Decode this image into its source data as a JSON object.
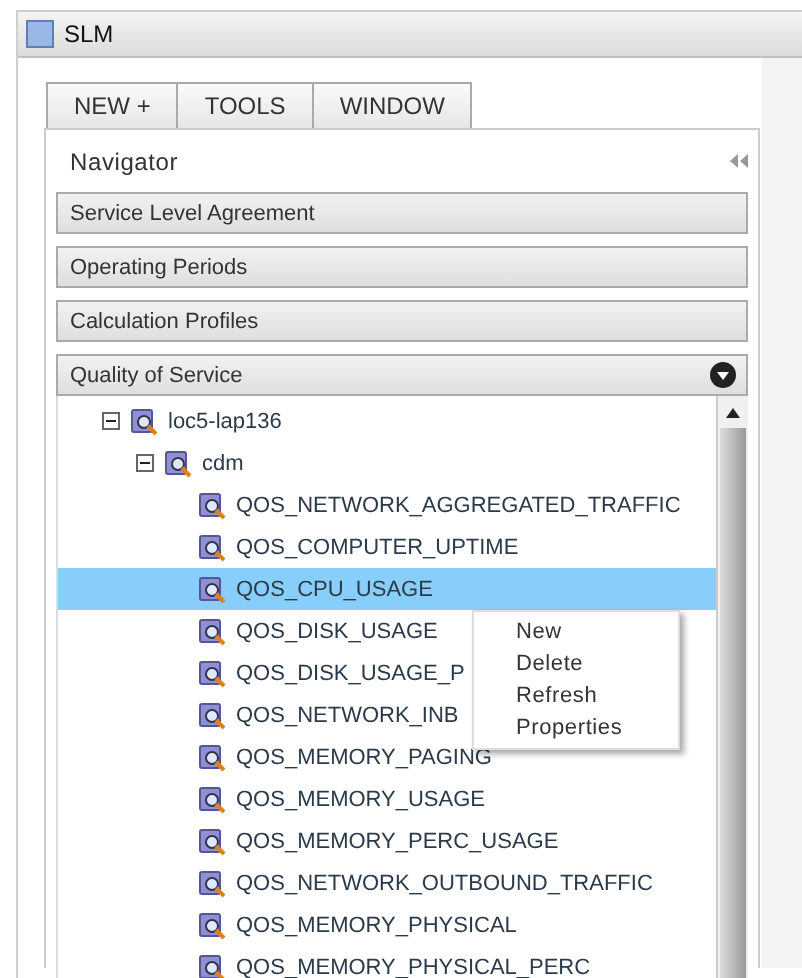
{
  "window": {
    "title": "SLM"
  },
  "menu_tabs": [
    {
      "label": "NEW +"
    },
    {
      "label": "TOOLS"
    },
    {
      "label": "WINDOW"
    }
  ],
  "navigator": {
    "title": "Navigator",
    "sections": [
      {
        "label": "Service Level Agreement",
        "expanded": false
      },
      {
        "label": "Operating Periods",
        "expanded": false
      },
      {
        "label": "Calculation Profiles",
        "expanded": false
      },
      {
        "label": "Quality of Service",
        "expanded": true
      }
    ]
  },
  "tree": [
    {
      "label": "loc5-lap136",
      "expanded": true,
      "selected": false,
      "children": [
        {
          "label": "cdm",
          "expanded": true,
          "selected": false,
          "children": [
            {
              "label": "QOS_NETWORK_AGGREGATED_TRAFFIC",
              "selected": false
            },
            {
              "label": "QOS_COMPUTER_UPTIME",
              "selected": false
            },
            {
              "label": "QOS_CPU_USAGE",
              "selected": true
            },
            {
              "label": "QOS_DISK_USAGE",
              "selected": false
            },
            {
              "label": "QOS_DISK_USAGE_P",
              "selected": false
            },
            {
              "label": "QOS_NETWORK_INB",
              "selected": false
            },
            {
              "label": "QOS_MEMORY_PAGING",
              "selected": false
            },
            {
              "label": "QOS_MEMORY_USAGE",
              "selected": false
            },
            {
              "label": "QOS_MEMORY_PERC_USAGE",
              "selected": false
            },
            {
              "label": "QOS_NETWORK_OUTBOUND_TRAFFIC",
              "selected": false
            },
            {
              "label": "QOS_MEMORY_PHYSICAL",
              "selected": false
            },
            {
              "label": "QOS_MEMORY_PHYSICAL_PERC",
              "selected": false
            }
          ]
        }
      ]
    }
  ],
  "context_menu": {
    "items": [
      "New",
      "Delete",
      "Refresh",
      "Properties"
    ]
  }
}
